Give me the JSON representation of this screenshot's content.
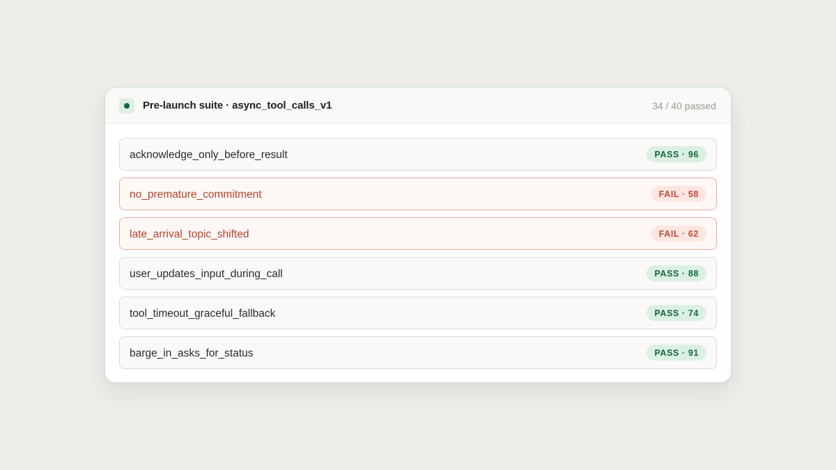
{
  "header": {
    "title": "Pre-launch suite · async_tool_calls_v1",
    "summary": "34 / 40 passed"
  },
  "tests": [
    {
      "name": "acknowledge_only_before_result",
      "status": "pass",
      "badge": "PASS · 96"
    },
    {
      "name": "no_premature_commitment",
      "status": "fail",
      "badge": "FAIL · 58"
    },
    {
      "name": "late_arrival_topic_shifted",
      "status": "fail",
      "badge": "FAIL · 62"
    },
    {
      "name": "user_updates_input_during_call",
      "status": "pass",
      "badge": "PASS · 88"
    },
    {
      "name": "tool_timeout_graceful_fallback",
      "status": "pass",
      "badge": "PASS · 74"
    },
    {
      "name": "barge_in_asks_for_status",
      "status": "pass",
      "badge": "PASS · 91"
    }
  ],
  "colors": {
    "pass_text": "#14683f",
    "pass_bg": "#dcefe3",
    "fail_text": "#c24a33",
    "fail_bg": "#fbe6e1",
    "fail_border": "#eca99d"
  },
  "icons": {
    "status_indicator": "status-dot-icon"
  }
}
